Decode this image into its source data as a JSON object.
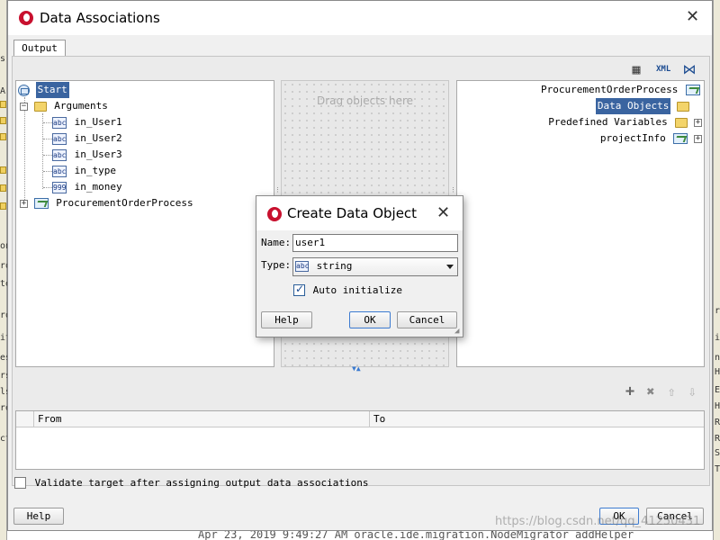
{
  "window": {
    "title": "Data Associations",
    "tab_label": "Output",
    "drop_hint": "Drag objects here"
  },
  "background": {
    "log_line": "Apr 23, 2019 9:49:27 AM oracle.ide.migration.NodeMigrator addHelper",
    "left_letters": [
      "s",
      "A",
      "on",
      "ro",
      "te",
      "ro",
      "it",
      "es",
      "rs",
      "ls",
      "re",
      "ct"
    ],
    "right_letters": [
      "ro",
      "it",
      "n",
      "Hr",
      "Ev",
      "Hu",
      "Re",
      "Ru",
      "Se",
      "Ty"
    ]
  },
  "source_tree": {
    "root": "Start",
    "arguments": "Arguments",
    "args": [
      {
        "label": "in_User1",
        "icon": "abc"
      },
      {
        "label": "in_User2",
        "icon": "abc"
      },
      {
        "label": "in_User3",
        "icon": "abc"
      },
      {
        "label": "in_type",
        "icon": "abc"
      },
      {
        "label": "in_money",
        "icon": "999"
      }
    ],
    "process": "ProcurementOrderProcess"
  },
  "target_tree": {
    "process": "ProcurementOrderProcess",
    "data_objects": "Data Objects",
    "predefined": "Predefined Variables",
    "project_info": "projectInfo"
  },
  "table": {
    "col_from": "From",
    "col_to": "To"
  },
  "validate": {
    "label": "Validate target after assigning output data associations",
    "checked": false
  },
  "buttons": {
    "help": "Help",
    "ok": "OK",
    "cancel": "Cancel"
  },
  "dialog": {
    "title": "Create Data Object",
    "name_label": "Name:",
    "name_value": "user1",
    "type_label": "Type:",
    "type_icon": "abc",
    "type_value": "string",
    "auto_init_label": "Auto initialize",
    "auto_init_checked": true,
    "help": "Help",
    "ok": "OK",
    "cancel": "Cancel"
  },
  "watermark": "https://blog.csdn.net/qq_41250431",
  "colors": {
    "selection": "#3a64a0",
    "brand": "#c8102e"
  }
}
